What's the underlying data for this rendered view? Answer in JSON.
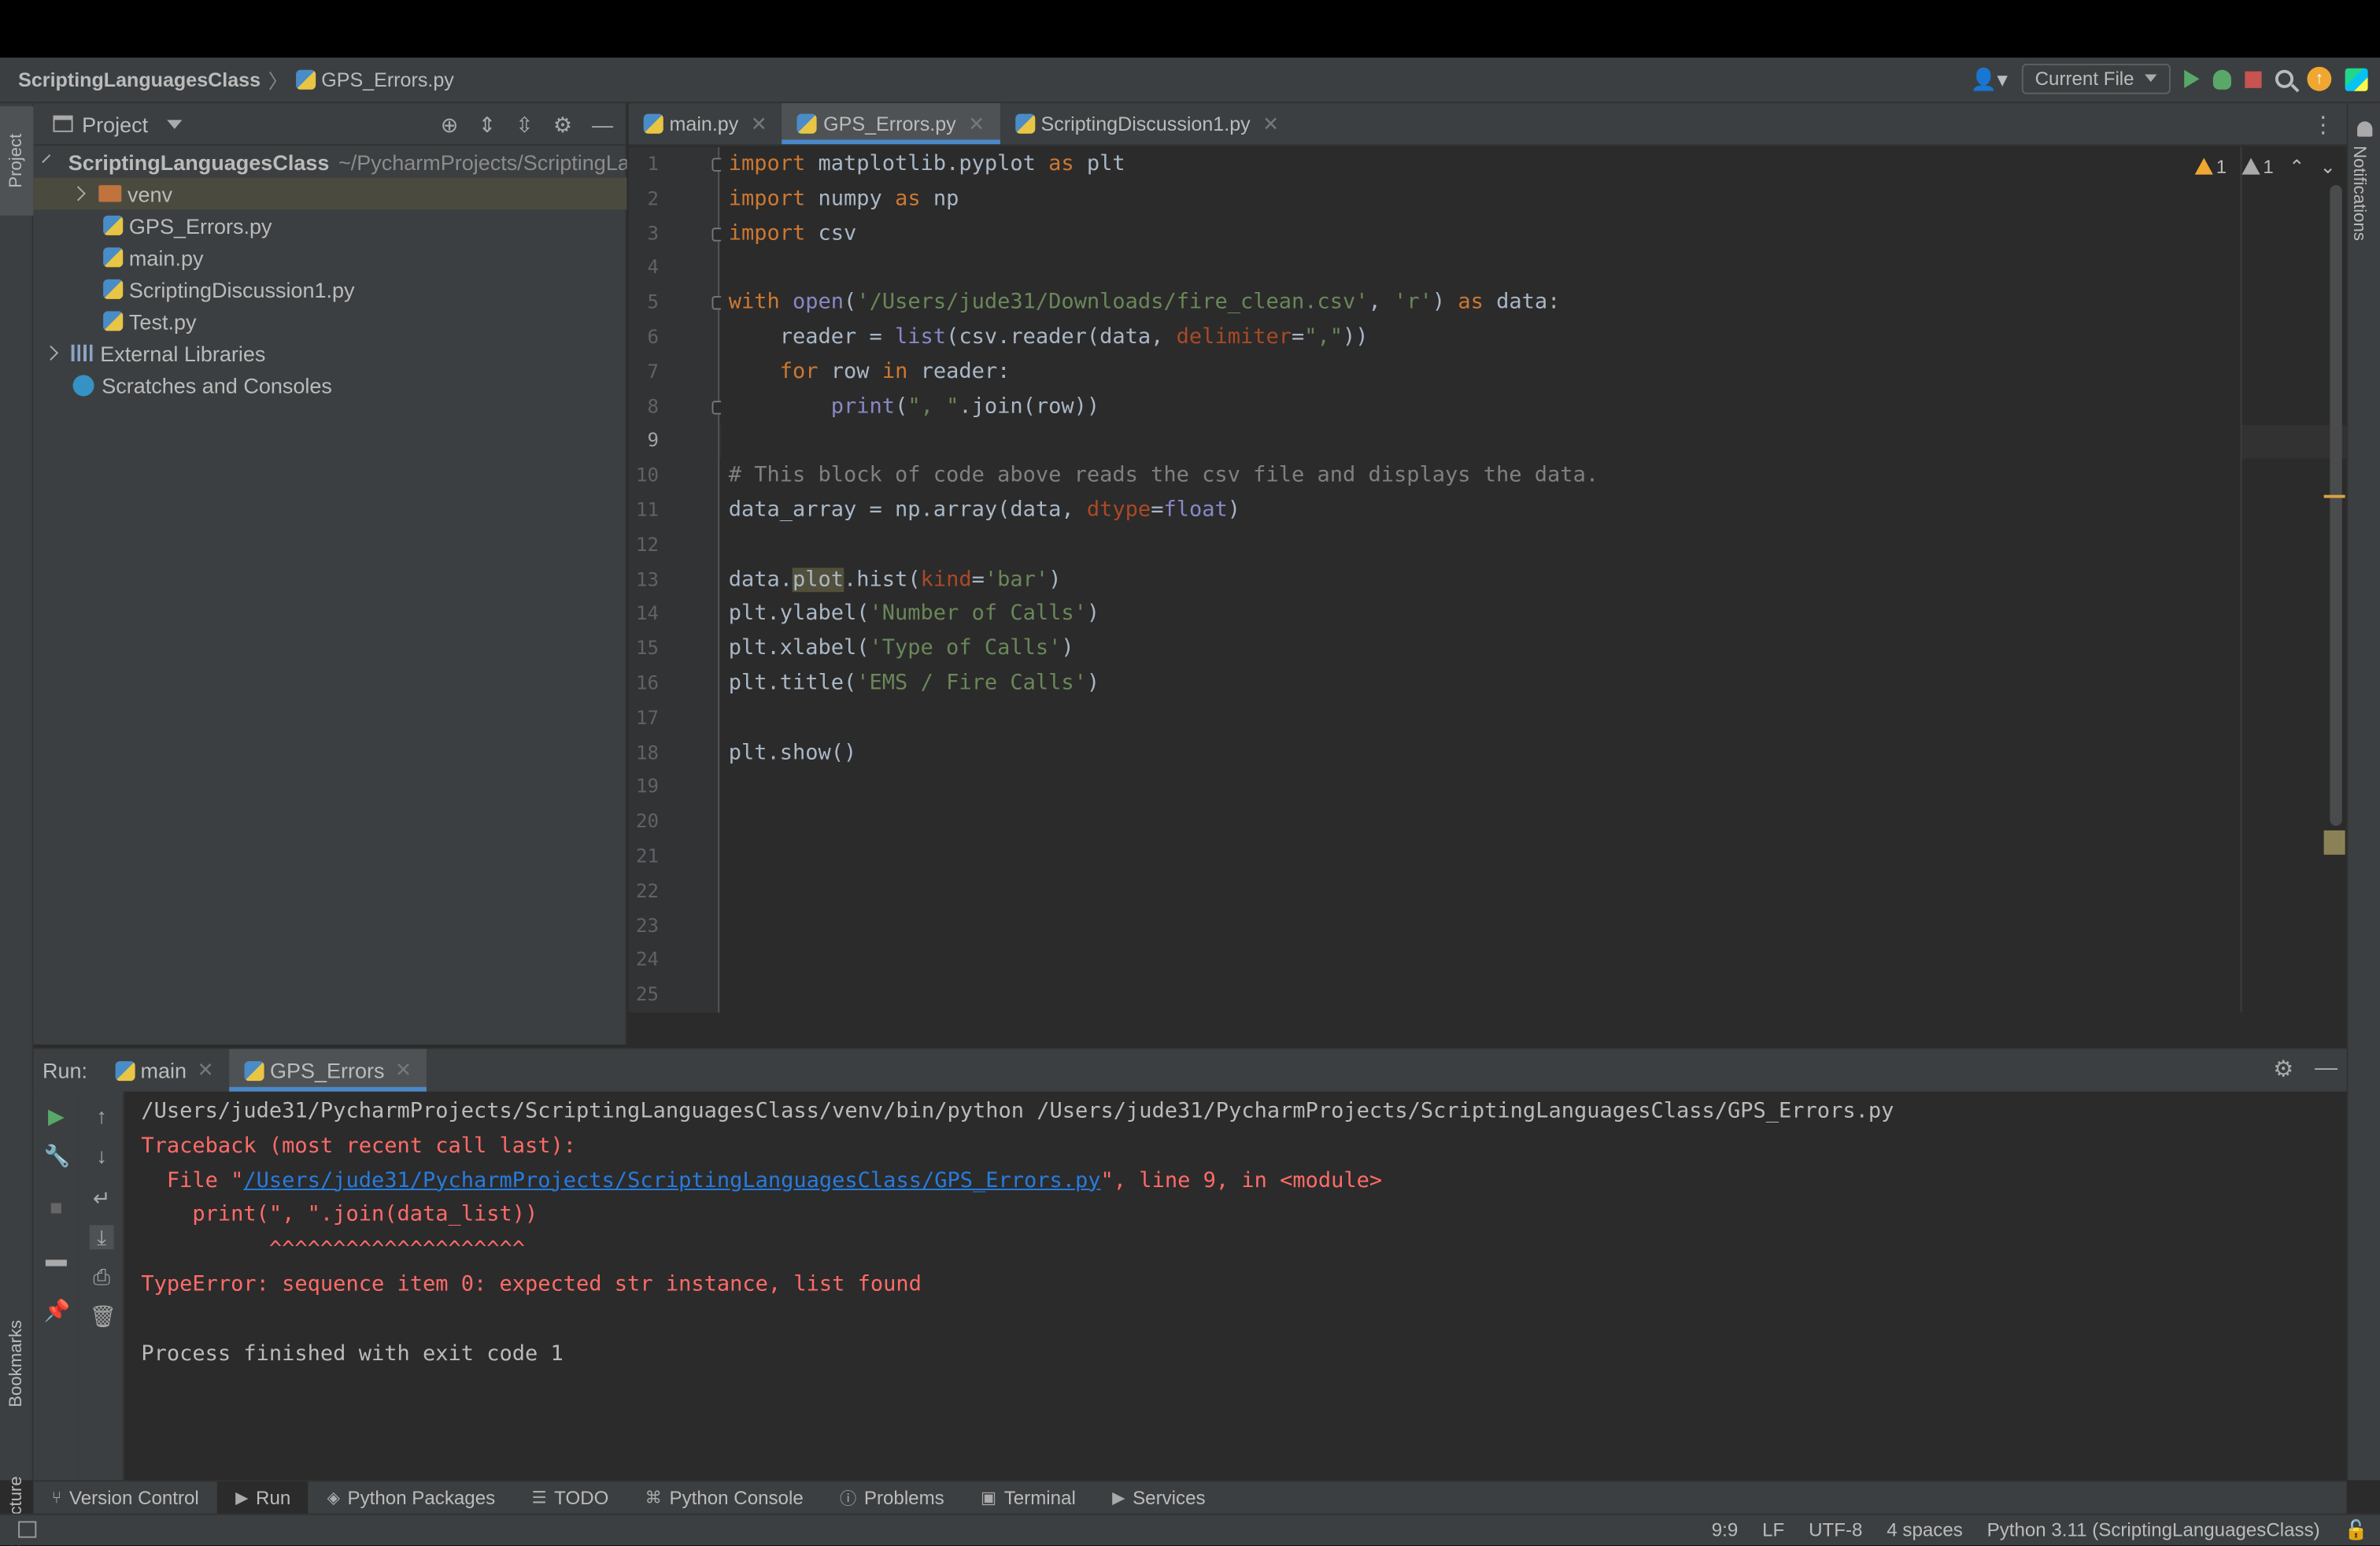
{
  "navbar": {
    "project": "ScriptingLanguagesClass",
    "file": "GPS_Errors.py",
    "run_config": "Current File"
  },
  "left_strip": {
    "project": "Project",
    "bookmarks": "Bookmarks",
    "structure": "Structure"
  },
  "right_strip": {
    "notifications": "Notifications"
  },
  "project_panel": {
    "title": "Project",
    "root": "ScriptingLanguagesClass",
    "root_path": "~/PycharmProjects/ScriptingLanguagesClass",
    "items": [
      "venv",
      "GPS_Errors.py",
      "main.py",
      "ScriptingDiscussion1.py",
      "Test.py"
    ],
    "external": "External Libraries",
    "scratches": "Scratches and Consoles"
  },
  "editor": {
    "tabs": [
      "main.py",
      "GPS_Errors.py",
      "ScriptingDiscussion1.py"
    ],
    "active_tab": 1,
    "warnings": "1",
    "weak_warnings": "1",
    "line_count": 25,
    "current_line": 9
  },
  "run": {
    "label": "Run:",
    "tabs": [
      "main",
      "GPS_Errors"
    ],
    "console": {
      "cmd": "/Users/jude31/PycharmProjects/ScriptingLanguagesClass/venv/bin/python /Users/jude31/PycharmProjects/ScriptingLanguagesClass/GPS_Errors.py",
      "traceback": "Traceback (most recent call last):",
      "file_prefix": "  File \"",
      "file_link": "/Users/jude31/PycharmProjects/ScriptingLanguagesClass/GPS_Errors.py",
      "file_suffix": "\", line 9, in <module>",
      "code_line": "    print(\", \".join(data_list))",
      "carets": "          ^^^^^^^^^^^^^^^^^^^^",
      "error": "TypeError: sequence item 0: expected str instance, list found",
      "exit": "Process finished with exit code 1"
    }
  },
  "tool_windows": [
    "Version Control",
    "Run",
    "Python Packages",
    "TODO",
    "Python Console",
    "Problems",
    "Terminal",
    "Services"
  ],
  "status": {
    "position": "9:9",
    "line_sep": "LF",
    "encoding": "UTF-8",
    "indent": "4 spaces",
    "interpreter": "Python 3.11 (ScriptingLanguagesClass)"
  },
  "colors": {
    "accent": "#4a88c7",
    "error_text": "#ff6b68",
    "keyword": "#cc7832",
    "string": "#6a8759"
  }
}
